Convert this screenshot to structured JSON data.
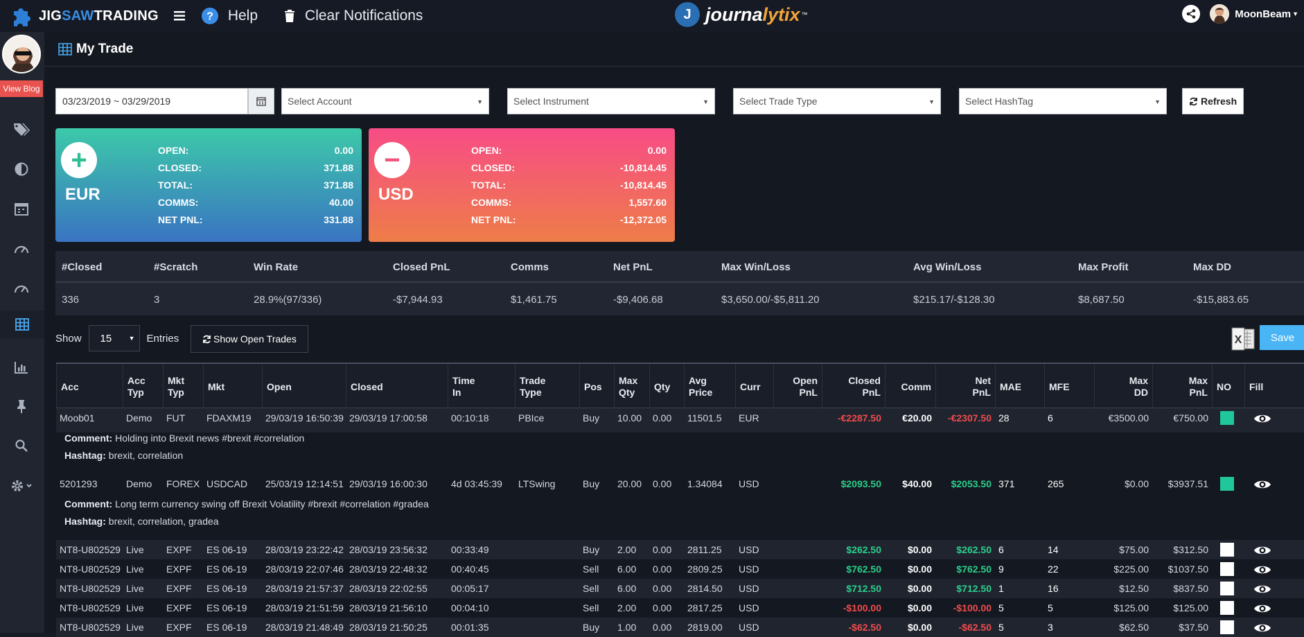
{
  "topbar": {
    "logo_part1": "JIG",
    "logo_part2": "SAW",
    "logo_part3": " TRADING",
    "help_label": "Help",
    "clear_label": "Clear Notifications",
    "brand_part1": "journa",
    "brand_part2": "lytix",
    "brand_tm": "™",
    "username": "MoonBeam"
  },
  "sidebar": {
    "view_blog": "View Blog",
    "icons": [
      "tags-icon",
      "contrast-icon",
      "calendar-icon",
      "speedometer-icon",
      "speedometer2-icon",
      "grid-icon",
      "bar-chart-icon",
      "pin-icon",
      "search-icon",
      "gear-icon"
    ]
  },
  "page_title": "My Trade",
  "filters": {
    "date_range": "03/23/2019 ~ 03/29/2019",
    "account_placeholder": "Select Account",
    "instrument_placeholder": "Select Instrument",
    "trade_type_placeholder": "Select Trade Type",
    "hashtag_placeholder": "Select HashTag",
    "refresh_label": "Refresh"
  },
  "cards": {
    "eur": {
      "currency": "EUR",
      "rows": [
        {
          "k": "OPEN:",
          "v": "0.00"
        },
        {
          "k": "CLOSED:",
          "v": "371.88"
        },
        {
          "k": "TOTAL:",
          "v": "371.88"
        },
        {
          "k": "COMMS:",
          "v": "40.00"
        },
        {
          "k": "NET PNL:",
          "v": "331.88"
        }
      ]
    },
    "usd": {
      "currency": "USD",
      "rows": [
        {
          "k": "OPEN:",
          "v": "0.00"
        },
        {
          "k": "CLOSED:",
          "v": "-10,814.45"
        },
        {
          "k": "TOTAL:",
          "v": "-10,814.45"
        },
        {
          "k": "COMMS:",
          "v": "1,557.60"
        },
        {
          "k": "NET PNL:",
          "v": "-12,372.05"
        }
      ]
    }
  },
  "stats": {
    "headers": [
      "#Closed",
      "#Scratch",
      "Win Rate",
      "Closed PnL",
      "Comms",
      "Net PnL",
      "Max Win/Loss",
      "Avg Win/Loss",
      "Max Profit",
      "Max DD"
    ],
    "values": [
      "336",
      "3",
      "28.9%(97/336)",
      "-$7,944.93",
      "$1,461.75",
      "-$9,406.68",
      "$3,650.00/-$5,811.20",
      "$215.17/-$128.30",
      "$8,687.50",
      "-$15,883.65"
    ]
  },
  "entries": {
    "show_label": "Show",
    "count": "15",
    "entries_label": "Entries",
    "open_trades_label": "Show Open Trades",
    "save_label": "Save"
  },
  "table": {
    "headers": [
      {
        "l1": "Acc",
        "l2": ""
      },
      {
        "l1": "Acc",
        "l2": "Typ"
      },
      {
        "l1": "Mkt",
        "l2": "Typ"
      },
      {
        "l1": "Mkt",
        "l2": ""
      },
      {
        "l1": "Open",
        "l2": ""
      },
      {
        "l1": "Closed",
        "l2": ""
      },
      {
        "l1": "Time",
        "l2": "In"
      },
      {
        "l1": "Trade",
        "l2": "Type"
      },
      {
        "l1": "Pos",
        "l2": ""
      },
      {
        "l1": "Max",
        "l2": "Qty"
      },
      {
        "l1": "Qty",
        "l2": ""
      },
      {
        "l1": "Avg",
        "l2": "Price"
      },
      {
        "l1": "Curr",
        "l2": ""
      },
      {
        "l1": "Open",
        "l2": "PnL"
      },
      {
        "l1": "Closed",
        "l2": "PnL"
      },
      {
        "l1": "Comm",
        "l2": ""
      },
      {
        "l1": "Net",
        "l2": "PnL"
      },
      {
        "l1": "MAE",
        "l2": ""
      },
      {
        "l1": "MFE",
        "l2": ""
      },
      {
        "l1": "Max",
        "l2": "DD"
      },
      {
        "l1": "Max",
        "l2": "PnL"
      },
      {
        "l1": "NO",
        "l2": ""
      },
      {
        "l1": "Fill",
        "l2": ""
      }
    ],
    "comment_label": "Comment:",
    "hashtag_label": "Hashtag:",
    "rows": [
      {
        "acc": "Moob01",
        "acctyp": "Demo",
        "mkttyp": "FUT",
        "mkt": "FDAXM19",
        "open": "29/03/19 16:50:39",
        "closed": "29/03/19 17:00:58",
        "time": "00:10:18",
        "ttype": "PBIce",
        "pos": "Buy",
        "maxqty": "10.00",
        "qty": "0.00",
        "avg": "11501.5",
        "curr": "EUR",
        "openpnl": "",
        "closedpnl": "-€2287.50",
        "comm": "€20.00",
        "netpnl": "-€2307.50",
        "mae": "28",
        "mfe": "6",
        "maxdd": "€3500.00",
        "maxpnl": "€750.00",
        "sign": "neg",
        "note": "green",
        "comment": "Holding into Brexit news #brexit #correlation",
        "hashtag": "brexit, correlation"
      },
      {
        "acc": "5201293",
        "acctyp": "Demo",
        "mkttyp": "FOREX",
        "mkt": "USDCAD",
        "open": "25/03/19 12:14:51",
        "closed": "29/03/19 16:00:30",
        "time": "4d 03:45:39",
        "ttype": "LTSwing",
        "pos": "Buy",
        "maxqty": "20.00",
        "qty": "0.00",
        "avg": "1.34084",
        "curr": "USD",
        "openpnl": "",
        "closedpnl": "$2093.50",
        "comm": "$40.00",
        "netpnl": "$2053.50",
        "mae": "371",
        "mfe": "265",
        "maxdd": "$0.00",
        "maxpnl": "$3937.51",
        "sign": "pos",
        "note": "green",
        "comment": "Long term currency swing off Brexit Volatility #brexit #correlation #gradea",
        "hashtag": "brexit, correlation, gradea"
      },
      {
        "acc": "NT8-U802529",
        "acctyp": "Live",
        "mkttyp": "EXPF",
        "mkt": "ES 06-19",
        "open": "28/03/19 23:22:42",
        "closed": "28/03/19 23:56:32",
        "time": "00:33:49",
        "ttype": "",
        "pos": "Buy",
        "maxqty": "2.00",
        "qty": "0.00",
        "avg": "2811.25",
        "curr": "USD",
        "openpnl": "",
        "closedpnl": "$262.50",
        "comm": "$0.00",
        "netpnl": "$262.50",
        "mae": "6",
        "mfe": "14",
        "maxdd": "$75.00",
        "maxpnl": "$312.50",
        "sign": "pos",
        "note": "white"
      },
      {
        "acc": "NT8-U802529",
        "acctyp": "Live",
        "mkttyp": "EXPF",
        "mkt": "ES 06-19",
        "open": "28/03/19 22:07:46",
        "closed": "28/03/19 22:48:32",
        "time": "00:40:45",
        "ttype": "",
        "pos": "Sell",
        "maxqty": "6.00",
        "qty": "0.00",
        "avg": "2809.25",
        "curr": "USD",
        "openpnl": "",
        "closedpnl": "$762.50",
        "comm": "$0.00",
        "netpnl": "$762.50",
        "mae": "9",
        "mfe": "22",
        "maxdd": "$225.00",
        "maxpnl": "$1037.50",
        "sign": "pos",
        "note": "white"
      },
      {
        "acc": "NT8-U802529",
        "acctyp": "Live",
        "mkttyp": "EXPF",
        "mkt": "ES 06-19",
        "open": "28/03/19 21:57:37",
        "closed": "28/03/19 22:02:55",
        "time": "00:05:17",
        "ttype": "",
        "pos": "Sell",
        "maxqty": "6.00",
        "qty": "0.00",
        "avg": "2814.50",
        "curr": "USD",
        "openpnl": "",
        "closedpnl": "$712.50",
        "comm": "$0.00",
        "netpnl": "$712.50",
        "mae": "1",
        "mfe": "16",
        "maxdd": "$12.50",
        "maxpnl": "$837.50",
        "sign": "pos",
        "note": "white"
      },
      {
        "acc": "NT8-U802529",
        "acctyp": "Live",
        "mkttyp": "EXPF",
        "mkt": "ES 06-19",
        "open": "28/03/19 21:51:59",
        "closed": "28/03/19 21:56:10",
        "time": "00:04:10",
        "ttype": "",
        "pos": "Sell",
        "maxqty": "2.00",
        "qty": "0.00",
        "avg": "2817.25",
        "curr": "USD",
        "openpnl": "",
        "closedpnl": "-$100.00",
        "comm": "$0.00",
        "netpnl": "-$100.00",
        "mae": "5",
        "mfe": "5",
        "maxdd": "$125.00",
        "maxpnl": "$125.00",
        "sign": "neg",
        "note": "white"
      },
      {
        "acc": "NT8-U802529",
        "acctyp": "Live",
        "mkttyp": "EXPF",
        "mkt": "ES 06-19",
        "open": "28/03/19 21:48:49",
        "closed": "28/03/19 21:50:25",
        "time": "00:01:35",
        "ttype": "",
        "pos": "Buy",
        "maxqty": "1.00",
        "qty": "0.00",
        "avg": "2819.00",
        "curr": "USD",
        "openpnl": "",
        "closedpnl": "-$62.50",
        "comm": "$0.00",
        "netpnl": "-$62.50",
        "mae": "5",
        "mfe": "3",
        "maxdd": "$62.50",
        "maxpnl": "$37.50",
        "sign": "neg",
        "note": "white"
      }
    ]
  }
}
